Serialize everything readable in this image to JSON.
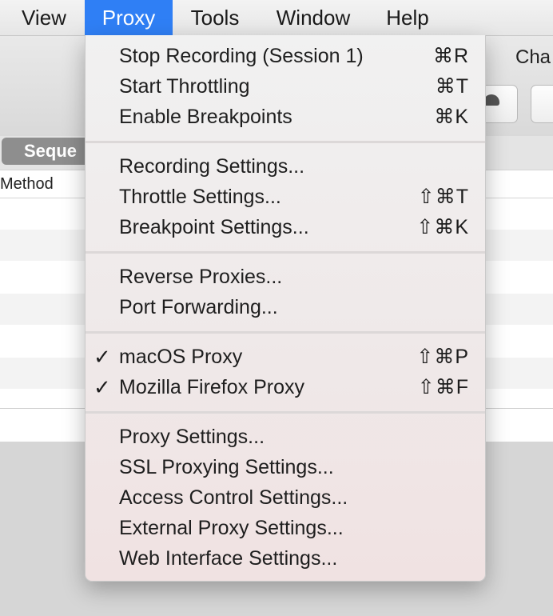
{
  "menubar": {
    "items": [
      {
        "label": "View"
      },
      {
        "label": "Proxy"
      },
      {
        "label": "Tools"
      },
      {
        "label": "Window"
      },
      {
        "label": "Help"
      }
    ]
  },
  "window": {
    "toolbar_label": "Cha",
    "sequence_tab": "Seque",
    "table": {
      "column_method": "Method"
    }
  },
  "proxy_menu": {
    "groups": [
      [
        {
          "label": "Stop Recording (Session 1)",
          "shortcut": "⌘R"
        },
        {
          "label": "Start Throttling",
          "shortcut": "⌘T"
        },
        {
          "label": "Enable Breakpoints",
          "shortcut": "⌘K"
        }
      ],
      [
        {
          "label": "Recording Settings...",
          "shortcut": ""
        },
        {
          "label": "Throttle Settings...",
          "shortcut": "⇧⌘T"
        },
        {
          "label": "Breakpoint Settings...",
          "shortcut": "⇧⌘K"
        }
      ],
      [
        {
          "label": "Reverse Proxies...",
          "shortcut": ""
        },
        {
          "label": "Port Forwarding...",
          "shortcut": ""
        }
      ],
      [
        {
          "label": "macOS Proxy",
          "shortcut": "⇧⌘P",
          "checked": true,
          "check": "✓"
        },
        {
          "label": "Mozilla Firefox Proxy",
          "shortcut": "⇧⌘F",
          "checked": true,
          "check": "✓"
        }
      ],
      [
        {
          "label": "Proxy Settings...",
          "shortcut": ""
        },
        {
          "label": "SSL Proxying Settings...",
          "shortcut": ""
        },
        {
          "label": "Access Control Settings...",
          "shortcut": ""
        },
        {
          "label": "External Proxy Settings...",
          "shortcut": ""
        },
        {
          "label": "Web Interface Settings...",
          "shortcut": ""
        }
      ]
    ]
  }
}
